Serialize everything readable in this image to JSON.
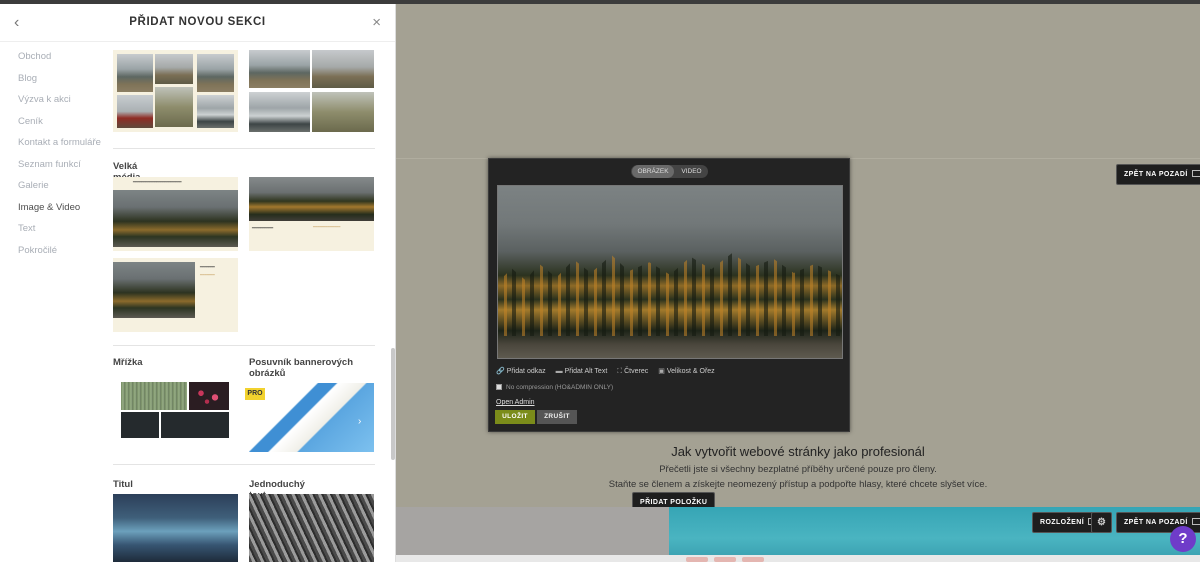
{
  "panel": {
    "back_glyph": "‹",
    "title": "PŘIDAT NOVOU SEKCI",
    "close_glyph": "×",
    "categories": [
      {
        "label": "Obchod",
        "active": false
      },
      {
        "label": "Blog",
        "active": false
      },
      {
        "label": "Výzva k akci",
        "active": false
      },
      {
        "label": "Ceník",
        "active": false
      },
      {
        "label": "Kontakt a formuláře",
        "active": false
      },
      {
        "label": "Seznam funkcí",
        "active": false
      },
      {
        "label": "Galerie",
        "active": false
      },
      {
        "label": "Image & Video",
        "active": true
      },
      {
        "label": "Text",
        "active": false
      },
      {
        "label": "Pokročilé",
        "active": false
      }
    ],
    "sections": {
      "large_media": "Velká média",
      "grid": "Mřížka",
      "banner_slider": "Posuvník bannerových obrázků",
      "title": "Titul",
      "simple_text": "Jednoduchý text"
    },
    "pro_badge": "PRO",
    "slider_arrow": "›"
  },
  "editor": {
    "tabs": [
      "OBRÁZEK",
      "VIDEO"
    ],
    "tools": [
      {
        "icon": "🔗",
        "label": "Přidat odkaz"
      },
      {
        "icon": "▬",
        "label": "Přidat Alt Text"
      },
      {
        "icon": "⛶",
        "label": "Čtverec"
      },
      {
        "icon": "▣",
        "label": "Velikost & Ořez"
      }
    ],
    "no_compression": "No compression (HO&ADMIN ONLY)",
    "open_admin": "Open Admin",
    "save": "ULOŽIT",
    "cancel": "ZRUŠIT"
  },
  "canvas": {
    "back_to_background": "ZPĚT NA POZADÍ",
    "layout": "ROZLOŽENÍ",
    "add_item": "PŘIDAT POLOŽKU",
    "headline": "Jak vytvořit webové stránky jako profesionál",
    "sub_line_1": "Přečetli jste si všechny bezplatné příběhy určené pouze pro členy.",
    "sub_line_2": "Staňte se členem a získejte neomezený přístup a podpořte hlasy, které chcete slyšet více.",
    "help": "?"
  },
  "colors": {
    "save_button": "#7b8c1a",
    "help_button": "#6f3cc9",
    "pro_badge": "#f2d22e",
    "canvas_bg": "#a4a193"
  }
}
